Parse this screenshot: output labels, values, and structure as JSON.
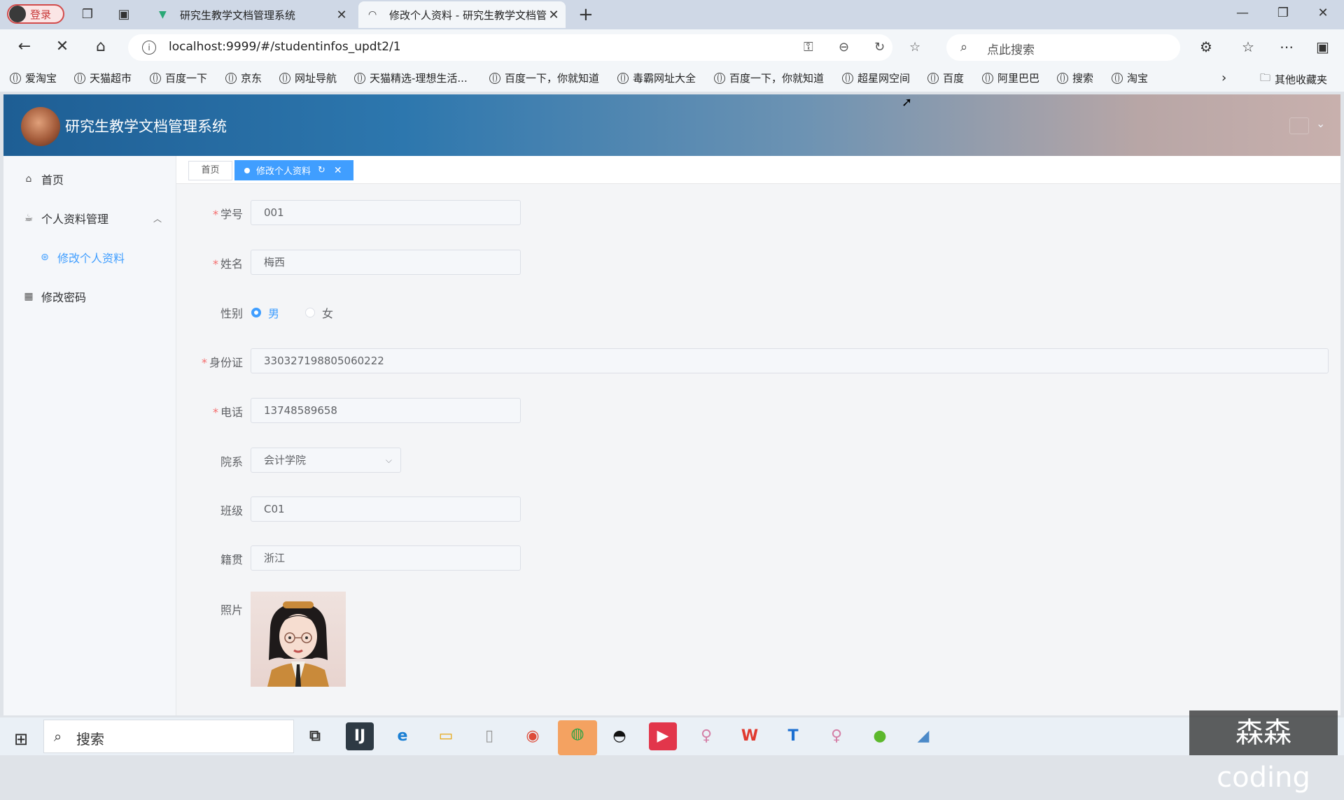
{
  "browser": {
    "profile_label": "登录",
    "tabs": [
      {
        "title": "研究生教学文档管理系统",
        "active": false
      },
      {
        "title": "修改个人资料 - 研究生教学文档管",
        "active": true
      }
    ],
    "address": "localhost:9999/#/studentinfos_updt2/1",
    "search_placeholder": "点此搜索",
    "bookmarks": [
      "爱淘宝",
      "天猫超市",
      "百度一下",
      "京东",
      "网址导航",
      "天猫精选-理想生活...",
      "百度一下，你就知道",
      "毒霸网址大全",
      "百度一下，你就知道",
      "超星网空间",
      "百度",
      "阿里巴巴",
      "搜索",
      "淘宝"
    ],
    "other_bookmarks": "其他收藏夹"
  },
  "app": {
    "title": "研究生教学文档管理系统"
  },
  "sidebar": {
    "items": [
      {
        "label": "首页",
        "icon": "home-icon"
      },
      {
        "label": "个人资料管理",
        "icon": "coffee-icon"
      },
      {
        "label": "修改个人资料",
        "icon": "settings-icon",
        "active": true
      },
      {
        "label": "修改密码",
        "icon": "grid-icon"
      }
    ]
  },
  "tags": {
    "home": "首页",
    "active": "修改个人资料"
  },
  "form": {
    "student_no": {
      "label": "学号",
      "value": "001"
    },
    "name": {
      "label": "姓名",
      "value": "梅西"
    },
    "gender": {
      "label": "性别",
      "options": [
        "男",
        "女"
      ],
      "selected": "男"
    },
    "id_card": {
      "label": "身份证",
      "value": "330327198805060222"
    },
    "phone": {
      "label": "电话",
      "value": "13748589658"
    },
    "department": {
      "label": "院系",
      "value": "会计学院"
    },
    "class": {
      "label": "班级",
      "value": "C01"
    },
    "hometown": {
      "label": "籍贯",
      "value": "浙江"
    },
    "photo": {
      "label": "照片"
    }
  },
  "taskbar": {
    "search_label": "搜索"
  },
  "watermark": "森森coding",
  "colors": {
    "primary": "#409eff",
    "required": "#f56c6c"
  }
}
